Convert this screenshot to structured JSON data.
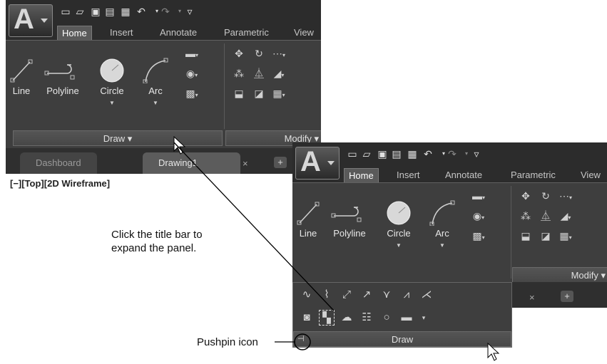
{
  "app": {
    "logo_letter": "A"
  },
  "ribbon_tabs": [
    "Home",
    "Insert",
    "Annotate",
    "Parametric",
    "View"
  ],
  "draw_tools": [
    {
      "label": "Line",
      "icon": "line-icon"
    },
    {
      "label": "Polyline",
      "icon": "polyline-icon"
    },
    {
      "label": "Circle",
      "icon": "circle-icon"
    },
    {
      "label": "Arc",
      "icon": "arc-icon"
    }
  ],
  "panels": {
    "draw": "Draw ▾",
    "draw_expanded": "Draw",
    "modify": "Modify ▾"
  },
  "doc_tabs": [
    "Dashboard",
    "Drawing1"
  ],
  "viewport_label": "[−][Top][2D Wireframe]",
  "callouts": {
    "expand": "Click the title bar to expand the panel.",
    "pushpin": "Pushpin icon"
  },
  "icons": {
    "quick_access": [
      "new-icon",
      "open-icon",
      "save-icon",
      "saveas-icon",
      "print-icon",
      "undo-icon",
      "redo-icon",
      "customize-icon"
    ],
    "expanded_row1": [
      "spline-fit-icon",
      "spline-cv-icon",
      "construction-line-icon",
      "ray-icon",
      "multiple-points-icon",
      "divide-icon",
      "measure-icon"
    ],
    "expanded_row2": [
      "region-icon",
      "wipeout-icon",
      "revision-cloud-icon",
      "hatch-icon",
      "donut-icon",
      "boundary-icon"
    ]
  },
  "colors": {
    "ribbon_bg": "#3e3e3e",
    "panel_bar": "#4f4f4f",
    "accent": "#5a5a5a"
  }
}
